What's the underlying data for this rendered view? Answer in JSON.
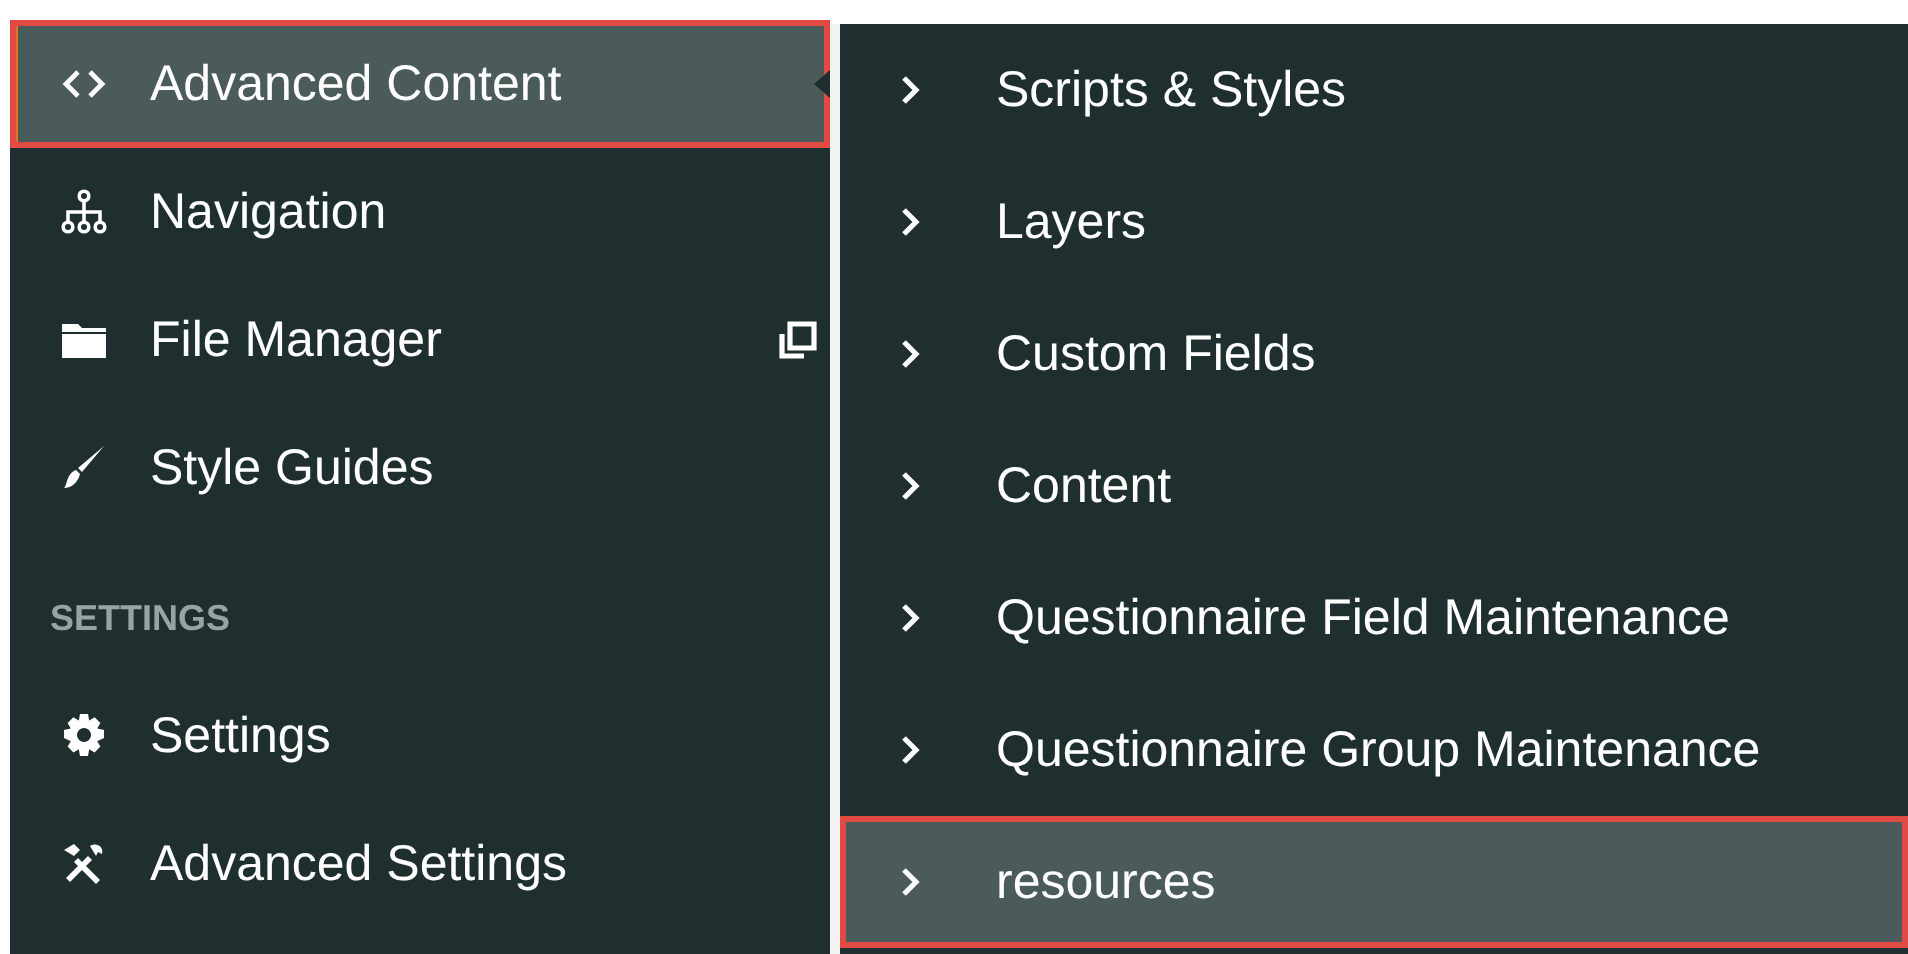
{
  "sidebar": {
    "groups": [
      {
        "items": [
          {
            "label": "Advanced Content",
            "selected": true,
            "highlighted": true,
            "expanded": true,
            "external": false
          },
          {
            "label": "Navigation",
            "selected": false,
            "highlighted": false,
            "expanded": false,
            "external": false
          },
          {
            "label": "File Manager",
            "selected": false,
            "highlighted": false,
            "expanded": false,
            "external": true
          },
          {
            "label": "Style Guides",
            "selected": false,
            "highlighted": false,
            "expanded": false,
            "external": false
          }
        ]
      },
      {
        "heading": "SETTINGS",
        "items": [
          {
            "label": "Settings",
            "selected": false,
            "highlighted": false,
            "expanded": false,
            "external": false
          },
          {
            "label": "Advanced Settings",
            "selected": false,
            "highlighted": false,
            "expanded": false,
            "external": false
          }
        ]
      }
    ]
  },
  "submenu": {
    "items": [
      {
        "label": "Scripts & Styles",
        "selected": false,
        "highlighted": false
      },
      {
        "label": "Layers",
        "selected": false,
        "highlighted": false
      },
      {
        "label": "Custom Fields",
        "selected": false,
        "highlighted": false
      },
      {
        "label": "Content",
        "selected": false,
        "highlighted": false
      },
      {
        "label": "Questionnaire Field Maintenance",
        "selected": false,
        "highlighted": false
      },
      {
        "label": "Questionnaire Group Maintenance",
        "selected": false,
        "highlighted": false
      },
      {
        "label": "resources",
        "selected": true,
        "highlighted": true
      }
    ]
  }
}
